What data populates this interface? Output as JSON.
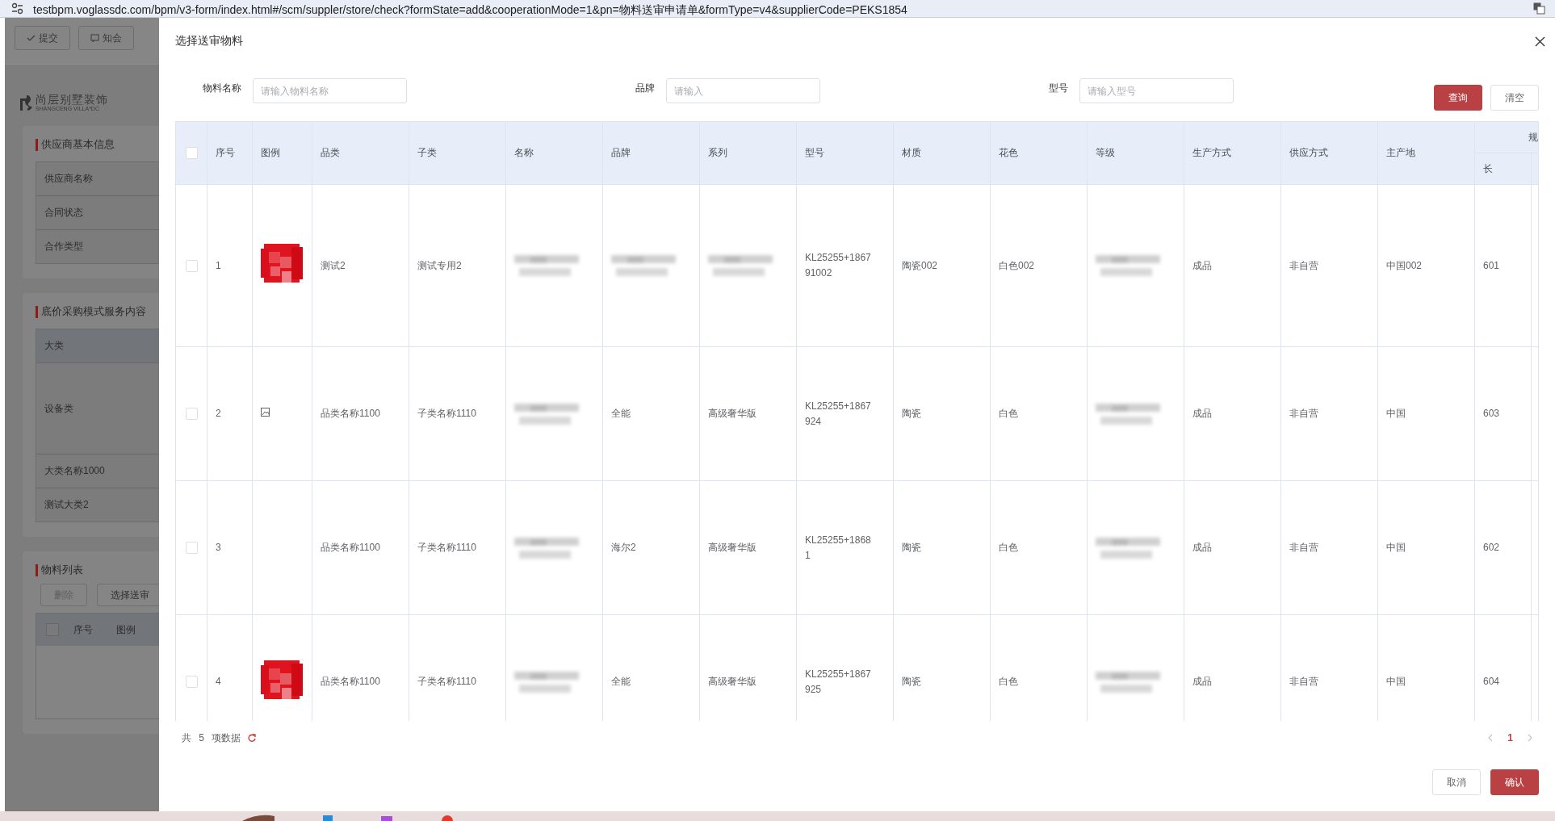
{
  "browser": {
    "url": "testbpm.voglassdc.com/bpm/v3-form/index.html#/scm/suppler/store/check?formState=add&cooperationMode=1&pn=物料送审申请单&formType=v4&supplierCode=PEKS1854"
  },
  "background_page": {
    "toolbar_buttons": [
      {
        "label": "提交"
      },
      {
        "label": "知会"
      }
    ],
    "logo": {
      "name": "尚层别墅装饰",
      "tagline": "SHANGCENG VILLA*DC"
    },
    "sections": [
      {
        "kind": "info",
        "title": "供应商基本信息",
        "rows": [
          {
            "label": "供应商名称",
            "kind": "plain"
          },
          {
            "label": "合同状态",
            "kind": "plain"
          },
          {
            "label": "合作类型",
            "kind": "plain"
          }
        ]
      },
      {
        "kind": "info",
        "title": "底价采购模式服务内容",
        "rows": [
          {
            "label": "大类",
            "kind": "header"
          },
          {
            "label": "设备类",
            "kind": "tall"
          },
          {
            "label": "大类名称1000",
            "kind": "plain"
          },
          {
            "label": "测试大类2",
            "kind": "plain"
          }
        ]
      },
      {
        "kind": "list",
        "title": "物料列表",
        "all_checked": false,
        "buttons": [
          {
            "label": "删除",
            "disabled": true
          },
          {
            "label": "选择送审",
            "disabled": false
          }
        ],
        "columns": [
          "序号",
          "图例"
        ]
      }
    ]
  },
  "dialog": {
    "title": "选择送审物料",
    "filters": [
      {
        "label": "物料名称",
        "placeholder": "请输入物料名称"
      },
      {
        "label": "品牌",
        "placeholder": "请输入"
      },
      {
        "label": "型号",
        "placeholder": "请输入型号"
      }
    ],
    "buttons": [
      {
        "label": "查询",
        "kind": "primary"
      },
      {
        "label": "清空",
        "kind": "plain"
      }
    ],
    "table": {
      "all_checked": false,
      "columns": [
        {
          "label": "序号"
        },
        {
          "label": "图例"
        },
        {
          "label": "品类"
        },
        {
          "label": "子类"
        },
        {
          "label": "名称"
        },
        {
          "label": "品牌"
        },
        {
          "label": "系列"
        },
        {
          "label": "型号"
        },
        {
          "label": "材质"
        },
        {
          "label": "花色"
        },
        {
          "label": "等级"
        },
        {
          "label": "生产方式"
        },
        {
          "label": "供应方式"
        },
        {
          "label": "主产地"
        }
      ],
      "group_column": {
        "label": "规",
        "children": [
          {
            "label": "长"
          }
        ]
      },
      "rows": [
        {
          "checked": false,
          "cells": [
            "1",
            {
              "kind": "picture"
            },
            "测试2",
            "测试专用2",
            {
              "kind": "blurred"
            },
            {
              "kind": "blurred"
            },
            {
              "kind": "blurred"
            },
            "KL25255+186791002",
            "陶瓷002",
            "白色002",
            {
              "kind": "blurred"
            },
            "成品",
            "非自营",
            "中国002",
            "601"
          ]
        },
        {
          "checked": false,
          "cells": [
            "2",
            {
              "kind": "broken"
            },
            "品类名称1100",
            "子类名称1110",
            {
              "kind": "blurred"
            },
            "全能",
            "高级奢华版",
            "KL25255+1867924",
            "陶瓷",
            "白色",
            {
              "kind": "blurred"
            },
            "成品",
            "非自营",
            "中国",
            "603"
          ]
        },
        {
          "checked": false,
          "cells": [
            "3",
            "",
            "品类名称1100",
            "子类名称1110",
            {
              "kind": "blurred"
            },
            "海尔2",
            "高级奢华版",
            "KL25255+18681",
            "陶瓷",
            "白色",
            {
              "kind": "blurred"
            },
            "成品",
            "非自营",
            "中国",
            "602"
          ]
        },
        {
          "checked": false,
          "cells": [
            "4",
            {
              "kind": "picture"
            },
            "品类名称1100",
            "子类名称1110",
            {
              "kind": "blurred"
            },
            "全能",
            "高级奢华版",
            "KL25255+1867925",
            "陶瓷",
            "白色",
            {
              "kind": "blurred"
            },
            "成品",
            "非自营",
            "中国",
            "604"
          ]
        }
      ]
    },
    "footer": {
      "total": "共 5 项数据",
      "pages": [
        {
          "label": "1",
          "selected": true
        }
      ]
    },
    "actions": [
      {
        "label": "取消",
        "kind": "plain"
      },
      {
        "label": "确认",
        "kind": "primary"
      }
    ]
  }
}
